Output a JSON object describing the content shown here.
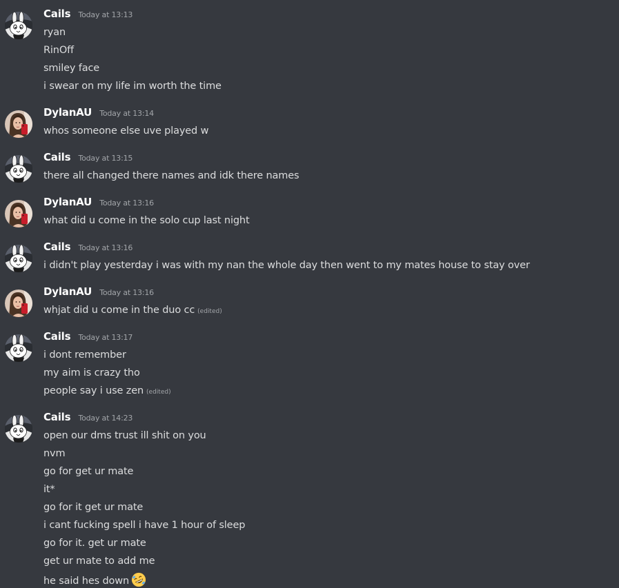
{
  "edited_label": "(edited)",
  "users": {
    "cails": "Cails",
    "dylan": "DylanAU"
  },
  "groups": [
    {
      "author": "Cails",
      "time": "Today at 13:13",
      "lines": [
        "ryan",
        "RinOff",
        "smiley face",
        "i swear on my life im worth the time"
      ]
    },
    {
      "author": "DylanAU",
      "time": "Today at 13:14",
      "lines": [
        "whos someone else uve played w"
      ]
    },
    {
      "author": "Cails",
      "time": "Today at 13:15",
      "lines": [
        "there all changed there names and idk there names"
      ]
    },
    {
      "author": "DylanAU",
      "time": "Today at 13:16",
      "lines": [
        "what did u come in the solo cup last night"
      ]
    },
    {
      "author": "Cails",
      "time": "Today at 13:16",
      "lines": [
        "i didn't play yesterday i was with my nan the whole day then went to my mates house to stay over"
      ]
    },
    {
      "author": "DylanAU",
      "time": "Today at 13:16",
      "lines": [
        "whjat did u come in the duo cc"
      ]
    },
    {
      "author": "Cails",
      "time": "Today at 13:17",
      "lines": [
        "i dont remember",
        "my aim is crazy tho",
        "people say i use zen"
      ]
    },
    {
      "author": "Cails",
      "time": "Today at 14:23",
      "lines": [
        "open our dms trust ill shit on you",
        "nvm",
        "go for get ur mate",
        "it*",
        "go for it get ur mate",
        "i cant fucking spell i have 1 hour of sleep",
        "go for it. get ur mate",
        "get ur mate to add me",
        "he said hes down"
      ]
    }
  ],
  "icons": {
    "cails_avatar": "bunny-avatar-icon",
    "dylan_avatar": "selfie-avatar-icon",
    "laughing_emoji": "rolling-on-floor-laughing-icon"
  }
}
